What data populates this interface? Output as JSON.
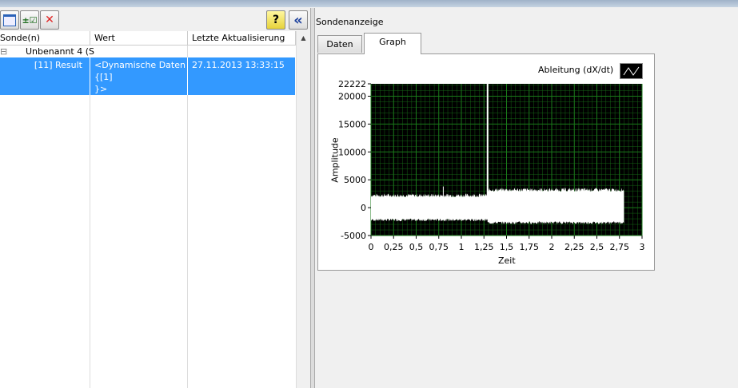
{
  "toolbar": {
    "help_label": "?",
    "collapse_label": "«"
  },
  "table": {
    "headers": [
      "Sonde(n)",
      "Wert",
      "Letzte Aktualisierung"
    ],
    "group": {
      "expander": "⊟",
      "label": "Unbenannt 4 (S"
    },
    "rows": [
      {
        "probe": "[11] Result",
        "value_lines": [
          "<Dynamische Daten",
          "{[1]",
          "}>"
        ],
        "updated": "27.11.2013 13:33:15"
      }
    ]
  },
  "right": {
    "title": "Sondenanzeige",
    "tabs": [
      "Daten",
      "Graph"
    ],
    "active_tab": "Graph"
  },
  "chart_data": {
    "type": "line",
    "legend": "Ableitung (dX/dt)",
    "legend_placement": "top-right",
    "xlabel": "Zeit",
    "ylabel": "Amplitude",
    "xlim": [
      0,
      3
    ],
    "ylim": [
      -5000,
      22222
    ],
    "xticks": [
      "0",
      "0,25",
      "0,5",
      "0,75",
      "1",
      "1,25",
      "1,5",
      "1,75",
      "2",
      "2,25",
      "2,5",
      "2,75",
      "3"
    ],
    "yticks": [
      "22222",
      "20000",
      "15000",
      "10000",
      "5000",
      "0",
      "-5000"
    ],
    "ytick_values": [
      22222,
      20000,
      15000,
      10000,
      5000,
      0,
      -5000
    ],
    "envelope": [
      {
        "x_start": 0,
        "x_end": 1.29,
        "upper": 2200,
        "lower": -2200
      },
      {
        "x_start": 1.29,
        "x_end": 2.8,
        "upper": 3200,
        "lower": -2700
      }
    ],
    "spikes": [
      {
        "x": 0.8,
        "y": 3800
      },
      {
        "x": 1.29,
        "y": 22222
      }
    ],
    "grid": true,
    "colors": {
      "background": "#000000",
      "grid": "#1a7a1a",
      "trace": "#ffffff"
    }
  }
}
